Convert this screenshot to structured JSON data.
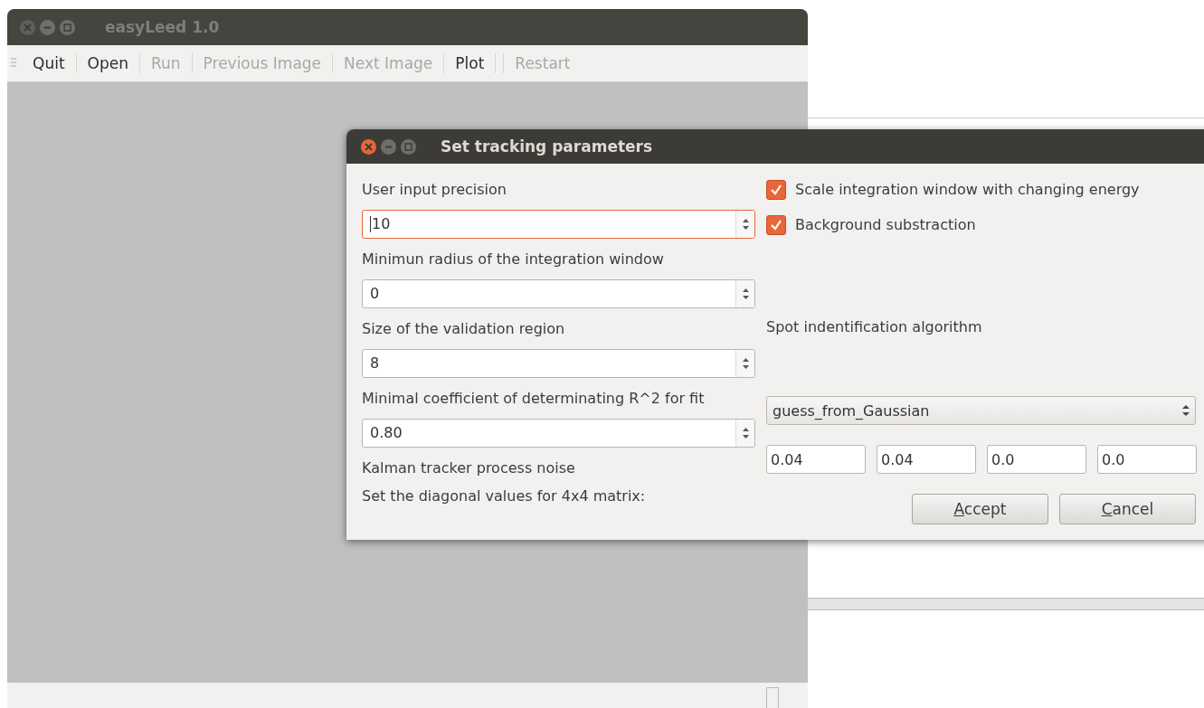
{
  "main_window": {
    "title": "easyLeed 1.0",
    "active": false
  },
  "toolbar": [
    {
      "kind": "action",
      "label": "Quit",
      "disabled": false
    },
    {
      "kind": "separator"
    },
    {
      "kind": "action",
      "label": "Open",
      "disabled": false
    },
    {
      "kind": "separator"
    },
    {
      "kind": "action",
      "label": "Run",
      "disabled": true
    },
    {
      "kind": "separator"
    },
    {
      "kind": "action",
      "label": "Previous Image",
      "disabled": true
    },
    {
      "kind": "separator"
    },
    {
      "kind": "action",
      "label": "Next Image",
      "disabled": true
    },
    {
      "kind": "separator"
    },
    {
      "kind": "action",
      "label": "Plot",
      "disabled": false
    },
    {
      "kind": "separator"
    },
    {
      "kind": "separator"
    },
    {
      "kind": "action",
      "label": "Restart",
      "disabled": true
    }
  ],
  "dialog": {
    "title": "Set tracking parameters",
    "active": true,
    "parameters": [
      {
        "label": "User input precision",
        "value": "10",
        "focused": true
      },
      {
        "label": "Minimun radius of the integration window",
        "value": "0",
        "focused": false
      },
      {
        "label": "Size of the validation region",
        "value": "8",
        "focused": false
      },
      {
        "label": "Minimal coefficient of determinating R^2 for fit",
        "value": "0.80",
        "focused": false
      }
    ],
    "options": [
      {
        "label": "Scale integration window with changing energy",
        "checked": true
      },
      {
        "label": "Background substraction",
        "checked": true
      }
    ],
    "algorithm": {
      "label": "Spot indentification algorithm",
      "value": "guess_from_Gaussian"
    },
    "noise": {
      "lines": [
        "Kalman tracker process noise",
        "Set the diagonal values for 4x4 matrix:"
      ],
      "values": [
        "0.04",
        "0.04",
        "0.0",
        "0.0"
      ]
    },
    "buttons": [
      {
        "label": "Accept",
        "mnemonic_underlined": true
      },
      {
        "label": "Cancel",
        "mnemonic_underlined": true
      }
    ]
  }
}
